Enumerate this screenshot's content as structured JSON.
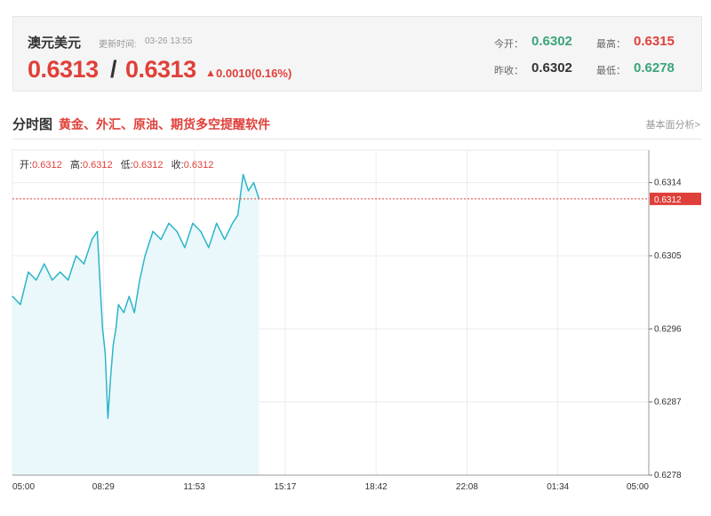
{
  "quote": {
    "name": "澳元美元",
    "time_label": "更新时间:",
    "time": "03-26 13:55",
    "bid": "0.6313",
    "slash": "/",
    "ask": "0.6313",
    "arrow": "▲",
    "change": "0.0010(0.16%)",
    "open_label": "今开：",
    "open": "0.6302",
    "high_label": "最高：",
    "high": "0.6315",
    "prev_label": "昨收：",
    "prev": "0.6302",
    "low_label": "最低：",
    "low": "0.6278"
  },
  "section": {
    "title": "分时图",
    "link": "黄金、外汇、原油、期货多空提醒软件",
    "more": "基本面分析>"
  },
  "ohlc": {
    "open_label": "开:",
    "open": "0.6312",
    "high_label": "高:",
    "high": "0.6312",
    "low_label": "低:",
    "low": "0.6312",
    "close_label": "收:",
    "close": "0.6312"
  },
  "colors": {
    "line": "#2bb5c9",
    "fill": "#eaf8fb",
    "up": "#e0403a",
    "down": "#3aa57a"
  },
  "chart_data": {
    "type": "area",
    "title": "",
    "xlabel": "",
    "ylabel": "",
    "ylim": [
      0.6278,
      0.6318
    ],
    "reference_value": 0.6312,
    "last_label": "0.6312",
    "yticks": [
      "0.6314",
      "0.6305",
      "0.6296",
      "0.6287",
      "0.6278"
    ],
    "ytick_values": [
      0.6314,
      0.6305,
      0.6296,
      0.6287,
      0.6278
    ],
    "xticks": [
      "05:00",
      "08:29",
      "11:53",
      "15:17",
      "18:42",
      "22:08",
      "01:34",
      "05:00"
    ],
    "x_hours": [
      0,
      0.3,
      0.6,
      0.9,
      1.2,
      1.5,
      1.8,
      2.1,
      2.4,
      2.7,
      3.0,
      3.2,
      3.3,
      3.4,
      3.5,
      3.6,
      3.7,
      3.8,
      3.9,
      4.0,
      4.2,
      4.4,
      4.6,
      4.8,
      5.0,
      5.3,
      5.6,
      5.9,
      6.2,
      6.5,
      6.8,
      7.1,
      7.4,
      7.7,
      8.0,
      8.3,
      8.5,
      8.7,
      8.9,
      9.1,
      9.3
    ],
    "values": [
      0.63,
      0.6299,
      0.6303,
      0.6302,
      0.6304,
      0.6302,
      0.6303,
      0.6302,
      0.6305,
      0.6304,
      0.6307,
      0.6308,
      0.6302,
      0.6296,
      0.6293,
      0.6285,
      0.629,
      0.6294,
      0.6296,
      0.6299,
      0.6298,
      0.63,
      0.6298,
      0.6302,
      0.6305,
      0.6308,
      0.6307,
      0.6309,
      0.6308,
      0.6306,
      0.6309,
      0.6308,
      0.6306,
      0.6309,
      0.6307,
      0.6309,
      0.631,
      0.6315,
      0.6313,
      0.6314,
      0.6312
    ],
    "series": [
      {
        "values": []
      }
    ]
  }
}
